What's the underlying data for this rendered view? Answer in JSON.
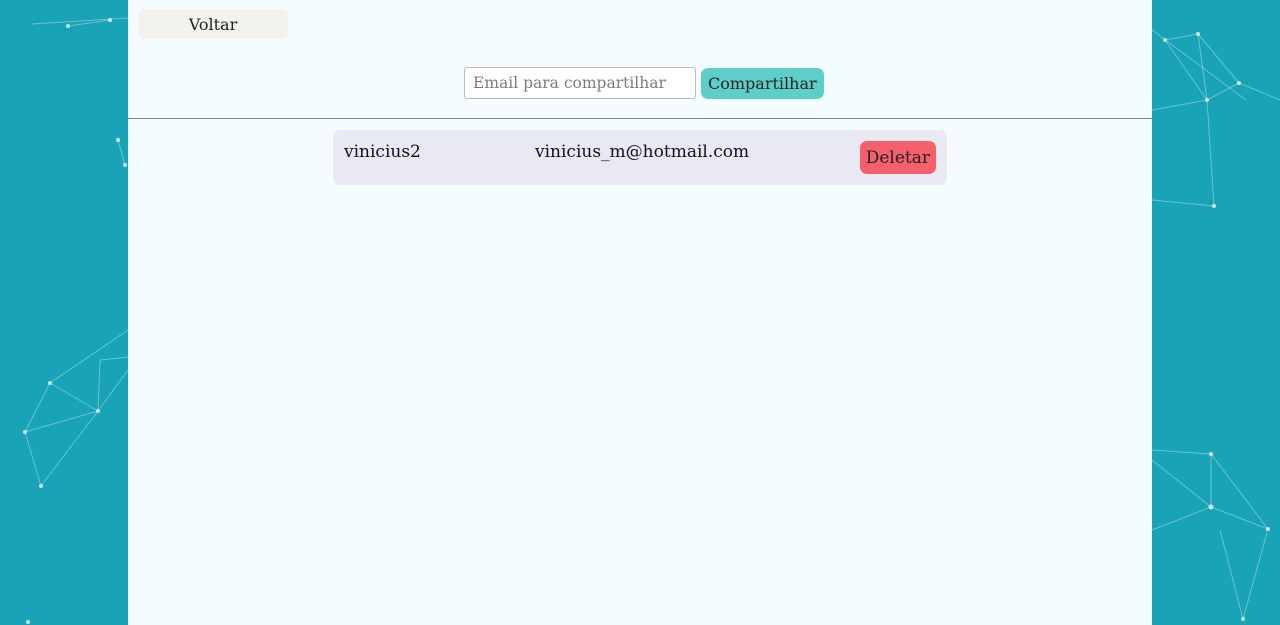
{
  "colors": {
    "background": "#19a3b6",
    "panel": "#f5fcfe",
    "back_button": "#f4f2ef",
    "share_button": "#5dcfc8",
    "delete_button": "#f65f6c",
    "row_background": "#e9e9f4"
  },
  "header": {
    "back_label": "Voltar"
  },
  "share": {
    "email_placeholder": "Email para compartilhar",
    "email_value": "",
    "share_label": "Compartilhar"
  },
  "shared_users": [
    {
      "name": "vinicius2",
      "email": "vinicius_m@hotmail.com",
      "delete_label": "Deletar"
    }
  ]
}
